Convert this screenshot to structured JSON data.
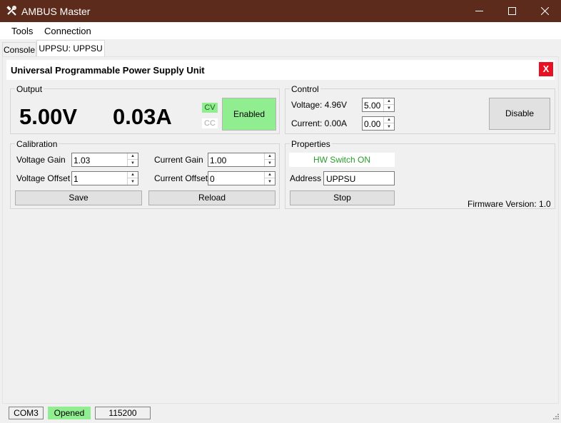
{
  "window": {
    "title": "AMBUS Master",
    "app_icon": "tools-icon",
    "controls": {
      "minimize": "minimize-icon",
      "maximize": "maximize-icon",
      "close": "close-icon"
    },
    "title_bar_color": "#5c2b1b"
  },
  "menu": {
    "items": [
      "Tools",
      "Connection"
    ]
  },
  "tabs": [
    {
      "label": "Console",
      "active": false
    },
    {
      "label": "UPPSU: UPPSU",
      "active": true
    }
  ],
  "header": {
    "title": "Universal Programmable Power Supply Unit",
    "close_label": "X",
    "close_color": "#e81123"
  },
  "output": {
    "group_label": "Output",
    "voltage": "5.00V",
    "current": "0.03A",
    "cv_label": "CV",
    "cc_label": "CC",
    "cv_active": true,
    "enabled_label": "Enabled",
    "enabled_color": "#90ee90"
  },
  "control": {
    "group_label": "Control",
    "voltage_label": "Voltage: 4.96V",
    "voltage_setpoint": "5.00",
    "current_label": "Current: 0.00A",
    "current_setpoint": "0.00",
    "disable_label": "Disable"
  },
  "calibration": {
    "group_label": "Calibration",
    "voltage_gain_label": "Voltage Gain",
    "voltage_gain": "1.03",
    "voltage_offset_label": "Voltage Offset",
    "voltage_offset": "1",
    "current_gain_label": "Current Gain",
    "current_gain": "1.00",
    "current_offset_label": "Current Offset",
    "current_offset": "0",
    "save_label": "Save",
    "reload_label": "Reload"
  },
  "properties": {
    "group_label": "Properties",
    "hw_switch": "HW Switch ON",
    "hw_switch_color": "#2a9d2a",
    "address_label": "Address",
    "address": "UPPSU",
    "stop_label": "Stop",
    "firmware": "Firmware Version: 1.0"
  },
  "statusbar": {
    "port": "COM3",
    "state": "Opened",
    "state_color": "#90ee90",
    "baud": "115200",
    "grip_icon": "resize-grip-icon"
  }
}
